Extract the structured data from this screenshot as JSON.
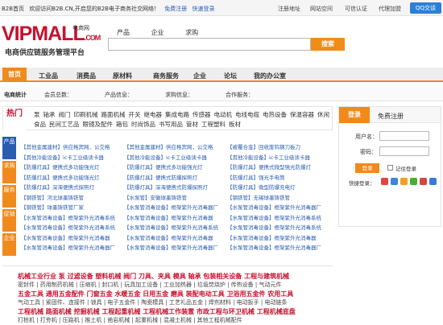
{
  "topbar": {
    "site": "B2B首页",
    "welcome": "欢迎访问B2B.CN,开启您的B2B电子商务社交网络！",
    "register": "免费注册",
    "login": "快速登录",
    "links": [
      "注册地址",
      "网站空间",
      "可信认证",
      "代理加盟"
    ],
    "qq": "QQ交谈"
  },
  "logo": {
    "main": "VIPMALL",
    "suffix": ".COM",
    "cn": "电商网",
    "slogan": "电商供应链服务管理平台"
  },
  "search": {
    "tabs": [
      "产品",
      "企业",
      "求购"
    ],
    "placeholder": "",
    "button": "搜索"
  },
  "nav": [
    "首页",
    "工业品",
    "消费品",
    "原材料",
    "商务服务",
    "企业",
    "论坛",
    "我的办公室"
  ],
  "stats": {
    "label": "电商统计",
    "items": [
      "会员总数：",
      "产品信息：",
      "求购信息：",
      "合作服务："
    ]
  },
  "hot": {
    "label": "热门",
    "items": [
      "泵",
      "轴承",
      "阀门",
      "印刷机械",
      "路面机械",
      "开关",
      "继电器",
      "集成电路",
      "传感器",
      "电动机",
      "电线电缆",
      "电热设备",
      "保温容器",
      "休闲食品",
      "民间工艺品",
      "眼镜及配件",
      "箱包",
      "时尚饰品",
      "书写用品",
      "管材",
      "工程塑料",
      "板材"
    ]
  },
  "prodtabs": [
    "产品",
    "求购",
    "服务",
    "促销",
    "企业"
  ],
  "products": [
    [
      "【其他金属建材】供应格宾网、公交格",
      "【其他金属建材】供应格宾网，公交格",
      "【被覆合金】回收废钨钢刀板刀",
      "["
    ],
    [
      "【其他冷能设备】ic卡工业级读卡器",
      "【其他冷能设备】ic卡工业级读卡器",
      "【其他冷能设备】ic卡工业级读卡器"
    ],
    [
      "【防爆灯具】便携式多功能强光灯",
      "【防爆灯具】便携式多功能强光灯",
      "【防爆灯具】便携式微型强光防爆灯"
    ],
    [
      "【防爆灯具】便携式多功能强光灯",
      "【防爆灯具】便携式防爆探照灯",
      "【防爆灯具】强光手电筒"
    ],
    [
      "【防爆灯具】深海便携式探照灯",
      "【防爆灯具】深海便携式防爆探照灯",
      "【防爆灯具】微型防爆充电灯"
    ],
    [
      "【钢铁管】河北球墨铸铁管",
      "【水泵管】安徽球墨铸铁管",
      "【钢铁管】无锡球墨铸铁管"
    ],
    [
      "【钢铁管】球墨铸铁管厂家",
      "【水泵管消毒设备】框架紫外光消毒器厂",
      "【水泵管消毒设备】框架紫外光消毒器厂"
    ],
    [
      "【水泵管消毒设备】框架紫外光消毒系统",
      "【水泵管消毒设备】框架紫外光消毒器",
      "【水泵管消毒设备】框架紫外光消毒系统"
    ],
    [
      "【水泵管消毒设备】框架紫外光消毒系统",
      "【水泵管消毒设备】框架紫外光消毒系统",
      "【水泵管消毒设备】框架紫外光消毒系统"
    ],
    [
      "【水泵管消毒设备】框架紫外光消毒器",
      "【水泵管消毒设备】框架紫外光消毒器",
      "【水泵管消毒设备】框架紫外光消毒器"
    ],
    [
      "【水泵管消毒设备】框架紫外光消毒器厂",
      "【水泵管消毒设备】框架紫外光消毒器厂",
      "【水泵管消毒设备】框架紫外光消毒器厂"
    ]
  ],
  "loginbox": {
    "tab1": "登录",
    "tab2": "免费注册",
    "user": "用户名：",
    "pass": "密码：",
    "button": "登录",
    "remember": "记住登录",
    "quick": "快捷登录："
  },
  "categories": [
    {
      "head": "机械工业行业 泵 过滤设备 塑料机械 阀门 刀具、夹具 模具 轴承 包装相关设备 工程与建筑机械",
      "items": "密封件 | 药用制药机械 | 压缩机 | 封口机 | 玩具加工设备 | 工业加热器 | 垃圾焚烧炉 | 传热设备 | 气动元件"
    },
    {
      "head": "五金工具 通用五金配件 门窗五金 水暖五金 日用五金 磨具 装配电动工具 卫浴用五金件 农用工具",
      "items": "气动工具 | 紧固件、连接件 | 锁具 | 电子五金件 | 陶瓷模具 | 工艺礼品五金 | 焊剂材料 | 电动扳手 | 电动链条"
    },
    {
      "head": "工程机械 路面机械 挖掘机械 工程起重机械 工程机械工作装置 市政工程与环卫机械 工程机械底盘",
      "items": "打桩机 | 打夯机 | 压路机 | 推土机 | 凿岩机械 | 起重机械 | 混凝土机械 | 其他工程机械配件"
    }
  ]
}
